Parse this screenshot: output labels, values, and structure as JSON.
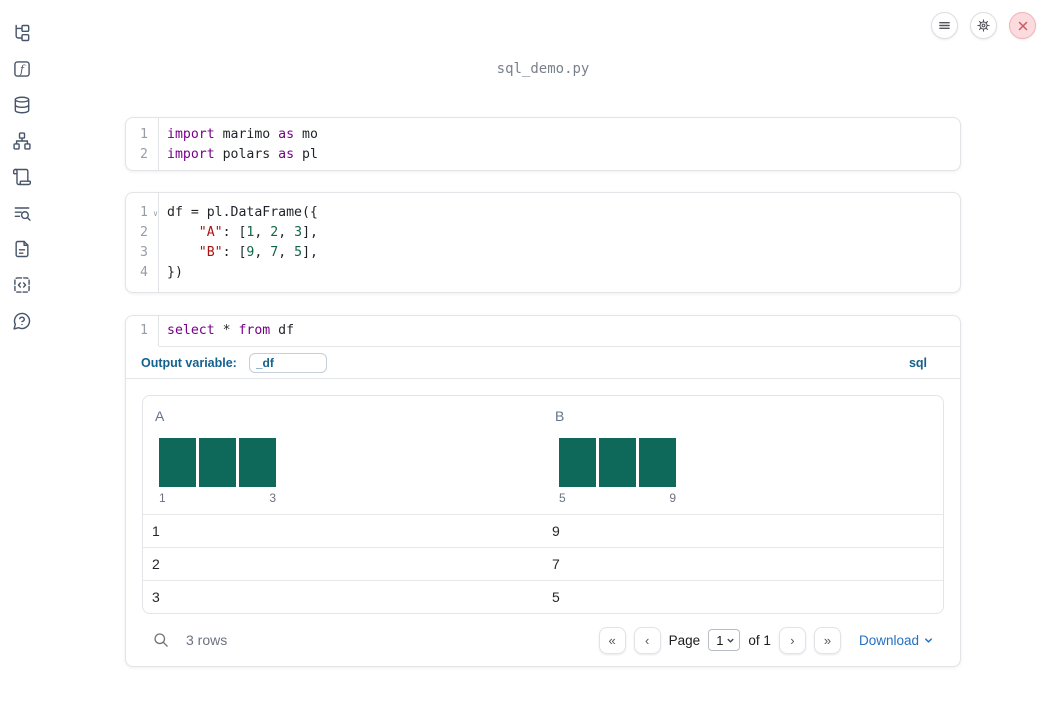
{
  "app": {
    "title": "sql_demo.py"
  },
  "colors": {
    "accent_blue": "#15618e",
    "link_blue": "#2270c4",
    "bar_teal": "#0e695a",
    "danger_red": "#cf5a62",
    "keyword": "#770088",
    "string": "#aa1111",
    "number": "#116644"
  },
  "sidebar": {
    "icons": [
      "file-tree",
      "function-square",
      "database",
      "dependency-graph",
      "scroll",
      "list-search",
      "document",
      "code-snippet",
      "help-bubble"
    ]
  },
  "topbar": {
    "buttons": [
      "menu",
      "settings",
      "shutdown"
    ]
  },
  "cells": [
    {
      "id": "imports",
      "lines": [
        {
          "n": "1",
          "tokens": [
            {
              "c": "kw",
              "t": "import"
            },
            {
              "c": "pl",
              "t": " marimo "
            },
            {
              "c": "kw",
              "t": "as"
            },
            {
              "c": "pl",
              "t": " mo"
            }
          ]
        },
        {
          "n": "2",
          "tokens": [
            {
              "c": "kw",
              "t": "import"
            },
            {
              "c": "pl",
              "t": " polars "
            },
            {
              "c": "kw",
              "t": "as"
            },
            {
              "c": "pl",
              "t": " pl"
            }
          ]
        }
      ]
    },
    {
      "id": "dataframe",
      "lines": [
        {
          "n": "1",
          "fold": true,
          "tokens": [
            {
              "c": "pl",
              "t": "df = pl.DataFrame({"
            }
          ]
        },
        {
          "n": "2",
          "tokens": [
            {
              "c": "pl",
              "t": "    "
            },
            {
              "c": "str",
              "t": "\"A\""
            },
            {
              "c": "pl",
              "t": ": ["
            },
            {
              "c": "num",
              "t": "1"
            },
            {
              "c": "pl",
              "t": ", "
            },
            {
              "c": "num",
              "t": "2"
            },
            {
              "c": "pl",
              "t": ", "
            },
            {
              "c": "num",
              "t": "3"
            },
            {
              "c": "pl",
              "t": "],"
            }
          ]
        },
        {
          "n": "3",
          "tokens": [
            {
              "c": "pl",
              "t": "    "
            },
            {
              "c": "str",
              "t": "\"B\""
            },
            {
              "c": "pl",
              "t": ": ["
            },
            {
              "c": "num",
              "t": "9"
            },
            {
              "c": "pl",
              "t": ", "
            },
            {
              "c": "num",
              "t": "7"
            },
            {
              "c": "pl",
              "t": ", "
            },
            {
              "c": "num",
              "t": "5"
            },
            {
              "c": "pl",
              "t": "],"
            }
          ]
        },
        {
          "n": "4",
          "tokens": [
            {
              "c": "pl",
              "t": "})"
            }
          ]
        }
      ]
    },
    {
      "id": "sql",
      "lines": [
        {
          "n": "1",
          "tokens": [
            {
              "c": "kw",
              "t": "select"
            },
            {
              "c": "pl",
              "t": " * "
            },
            {
              "c": "kw",
              "t": "from"
            },
            {
              "c": "pl",
              "t": " df"
            }
          ]
        }
      ]
    }
  ],
  "sql_cell": {
    "output_variable_label": "Output variable:",
    "output_variable_value": "_df",
    "language_badge": "sql"
  },
  "table": {
    "columns": [
      {
        "name": "A",
        "histogram": {
          "values": [
            1,
            1,
            1
          ],
          "min_label": "1",
          "max_label": "3"
        }
      },
      {
        "name": "B",
        "histogram": {
          "values": [
            1,
            1,
            1
          ],
          "min_label": "5",
          "max_label": "9"
        }
      }
    ],
    "rows": [
      [
        "1",
        "9"
      ],
      [
        "2",
        "7"
      ],
      [
        "3",
        "5"
      ]
    ],
    "footer": {
      "row_count": "3 rows",
      "pager": {
        "first": "«",
        "prev": "‹",
        "page_label": "Page",
        "page_value": "1",
        "of_label": "of 1",
        "next": "›",
        "last": "»"
      },
      "download_label": "Download"
    }
  }
}
